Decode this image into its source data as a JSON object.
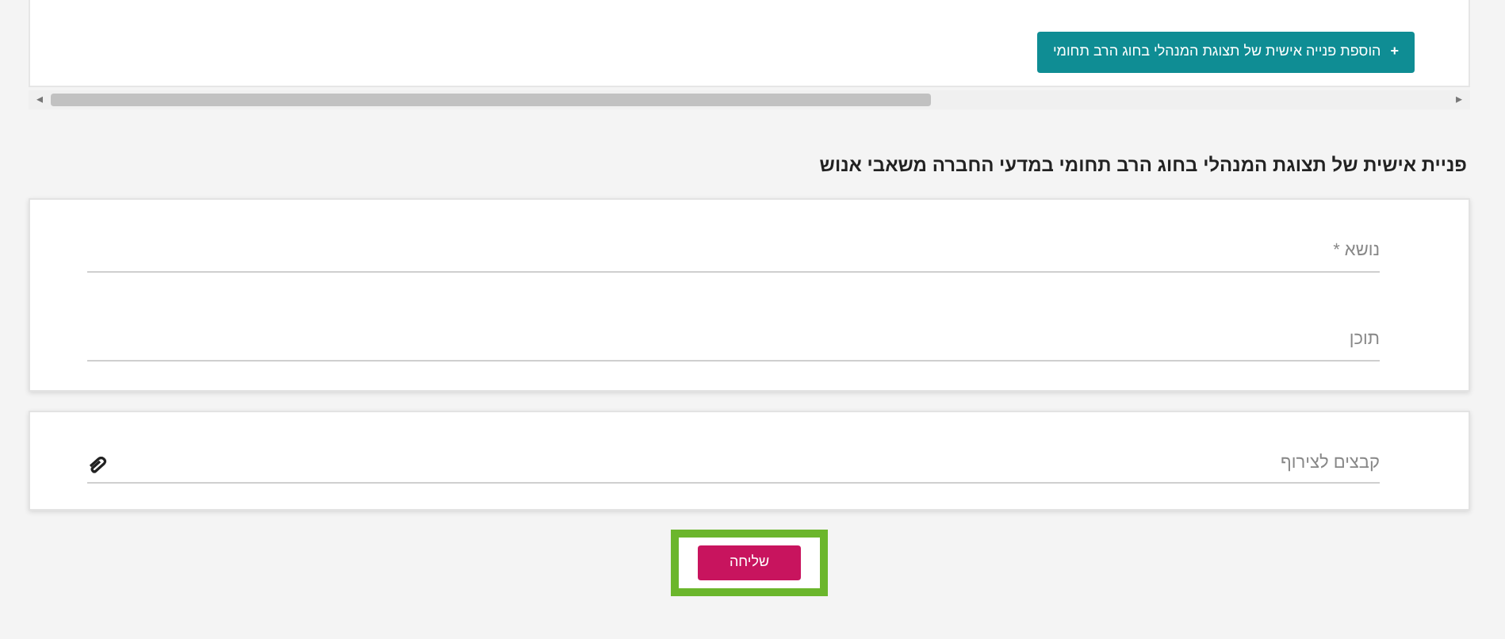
{
  "top_card": {
    "add_button": {
      "icon": "+",
      "label": "הוספת פנייה אישית של תצוגת המנהלי בחוג הרב תחומי"
    }
  },
  "scrollbar": {
    "left_arrow": "◂",
    "right_arrow": "▸"
  },
  "heading": "פניית אישית של תצוגת המנהלי בחוג הרב תחומי במדעי החברה משאבי אנוש",
  "form_fields": [
    {
      "label": "נושא *",
      "kind": "text"
    },
    {
      "label": "תוכן",
      "kind": "textarea"
    }
  ],
  "attachment": {
    "label": "קבצים לצירוף"
  },
  "submit": {
    "label": "שליחה",
    "highlighted": true
  }
}
